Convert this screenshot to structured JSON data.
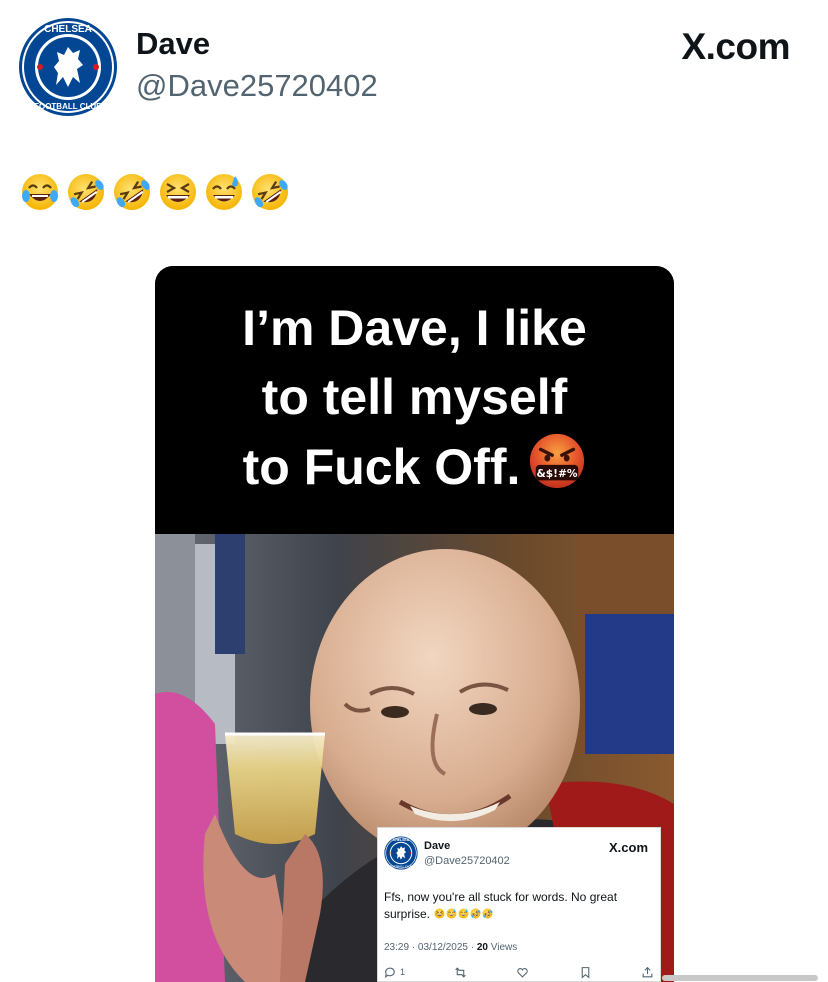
{
  "post": {
    "author_name": "Dave",
    "author_handle": "@Dave25720402",
    "brand": "X.com",
    "text_emojis": [
      "face-with-tears-of-joy",
      "rolling-on-floor-laughing",
      "rolling-on-floor-laughing",
      "grinning-squinting-face",
      "grinning-face-with-sweat",
      "rolling-on-floor-laughing"
    ]
  },
  "meme": {
    "caption_lines": [
      "I’m Dave, I like",
      "to tell myself",
      "to Fuck Off."
    ],
    "caption_emoji": "face-with-symbols-on-mouth",
    "emoji_symbols": "&$!#%"
  },
  "quoted_post": {
    "author_name": "Dave",
    "author_handle": "@Dave25720402",
    "brand": "X.com",
    "text": "Ffs,  now you're all stuck for words. No great surprise.",
    "text_emojis": [
      "grinning-squinting-face",
      "grinning-face-with-sweat",
      "grinning-face-with-sweat",
      "rolling-on-floor-laughing",
      "rolling-on-floor-laughing"
    ],
    "timestamp": "23:29 · 03/12/2025 · ",
    "views_count": "20",
    "views_label": " Views",
    "reply_count": "1"
  },
  "colors": {
    "text_primary": "#0f1419",
    "text_secondary": "#536471",
    "chelsea_blue": "#034694",
    "emoji_yellow": "#fcc21b",
    "rage_red": "#e0402a"
  }
}
